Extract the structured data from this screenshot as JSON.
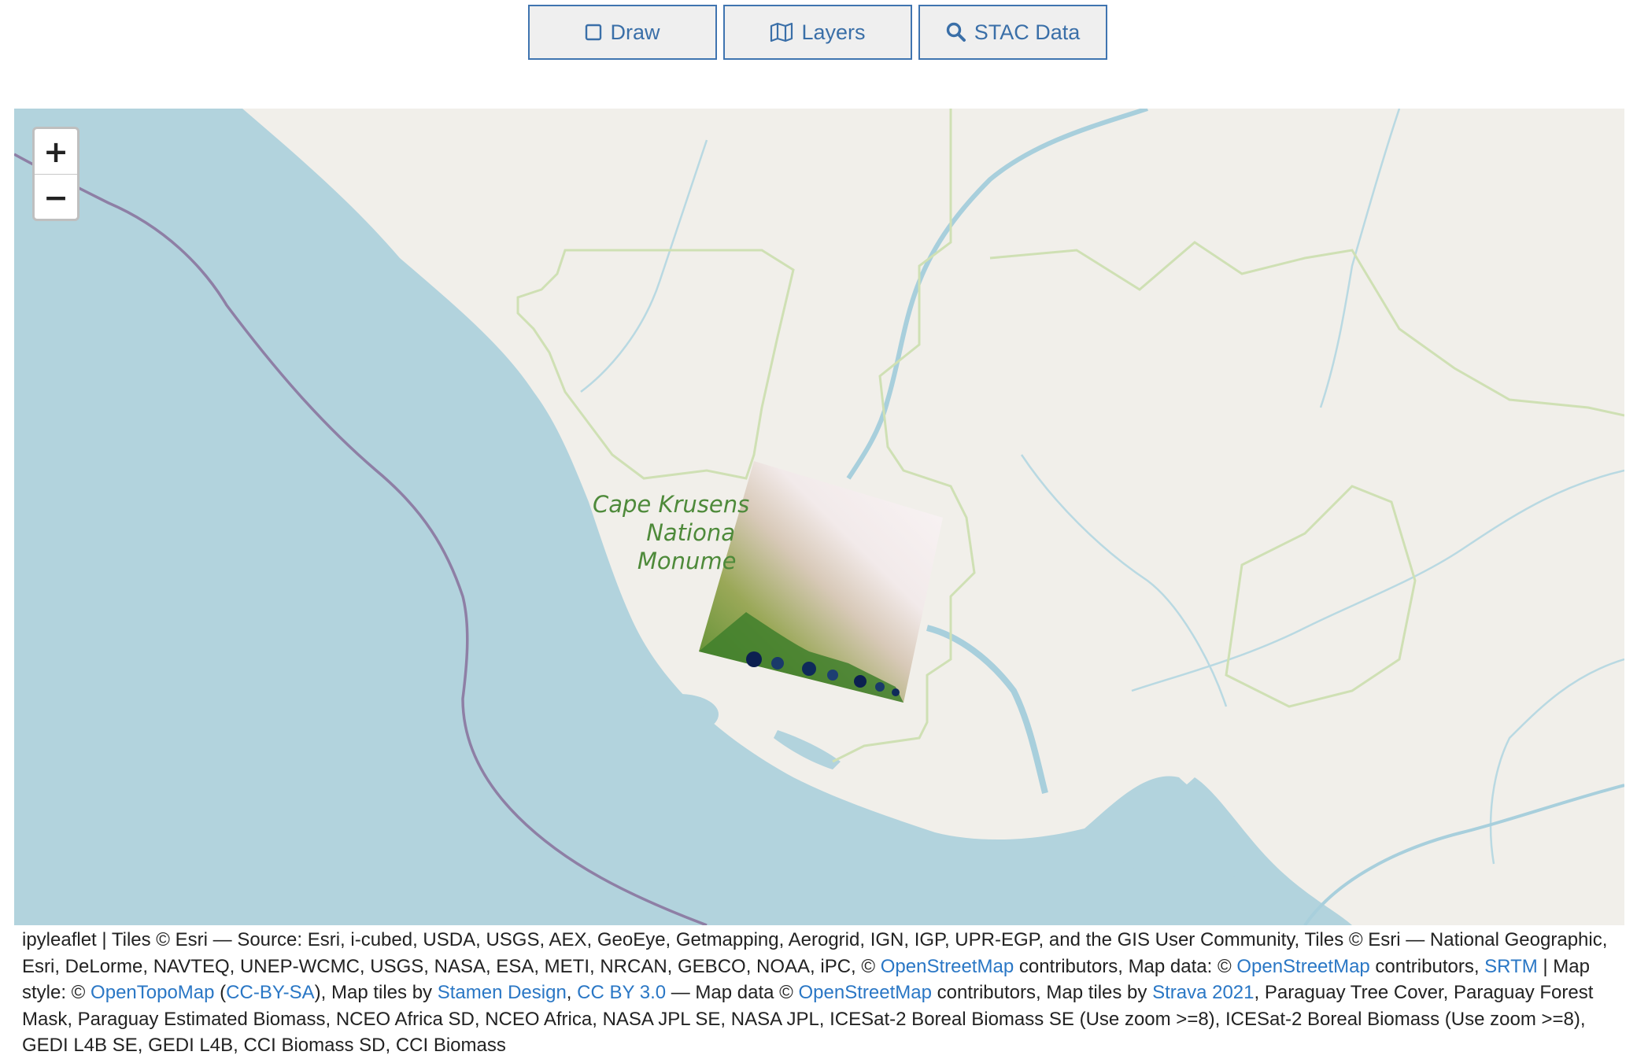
{
  "toolbar": {
    "draw_label": "Draw",
    "layers_label": "Layers",
    "stac_label": "STAC Data"
  },
  "map": {
    "zoom_in": "+",
    "zoom_out": "−",
    "place_label": {
      "line1": "Cape Krusens",
      "line2": "Nationa",
      "line3": "Monume"
    }
  },
  "attribution": {
    "t1": "ipyleaflet | Tiles © Esri — Source: Esri, i-cubed, USDA, USGS, AEX, GeoEye, Getmapping, Aerogrid, IGN, IGP, UPR-EGP, and the GIS User Community, Tiles © Esri — National Geographic, Esri, DeLorme, NAVTEQ, UNEP-WCMC, USGS, NASA, ESA, METI, NRCAN, GEBCO, NOAA, iPC, © ",
    "l1": "OpenStreetMap",
    "t2": " contributors, Map data: © ",
    "l2": "OpenStreetMap",
    "t3": " contributors, ",
    "l3": "SRTM",
    "t4": " | Map style: © ",
    "l4": "OpenTopoMap",
    "t5": " (",
    "l5": "CC-BY-SA",
    "t6": "), Map tiles by ",
    "l6": "Stamen Design",
    "t7": ", ",
    "l7": "CC BY 3.0",
    "t8": " — Map data © ",
    "l8": "OpenStreetMap",
    "t9": " contributors, Map tiles by ",
    "l9": "Strava 2021",
    "t10": ", Paraguay Tree Cover, Paraguay Forest Mask, Paraguay Estimated Biomass, NCEO Africa SD, NCEO Africa, NASA JPL SE, NASA JPL, ICESat-2 Boreal Biomass SE (Use zoom >=8), ICESat-2 Boreal Biomass (Use zoom >=8), GEDI L4B SE, GEDI L4B, CCI Biomass SD, CCI Biomass"
  },
  "colors": {
    "water": "#b2d3dd",
    "land": "#f1efea",
    "park_boundary": "#cfe0b4",
    "river": "#a8cfdc",
    "maritime_boundary": "#8e7fa5",
    "link": "#2a77c5",
    "button_text": "#3a6fa8"
  }
}
